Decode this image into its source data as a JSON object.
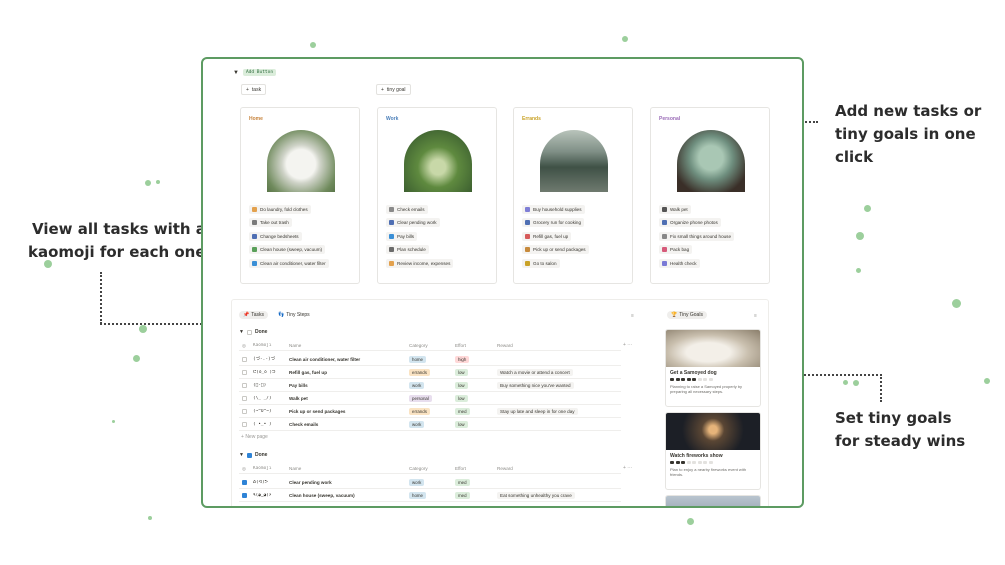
{
  "callouts": {
    "left": [
      "View all tasks with a",
      "kaomoji for each one"
    ],
    "top_right": [
      "Add new tasks or",
      "tiny goals in one",
      "click"
    ],
    "bottom_right": [
      "Set tiny goals",
      "for steady wins"
    ]
  },
  "toggle_label": "Add Button",
  "buttons": {
    "task": "task",
    "tiny_goal": "tiny goal"
  },
  "cards": [
    {
      "title": "Home",
      "color": "#c7833c",
      "items": [
        {
          "label": "Do laundry, fold clothes",
          "icon_color": "#e3a14d"
        },
        {
          "label": "Take out trash",
          "icon_color": "#7a7a7a"
        },
        {
          "label": "Change bedsheets",
          "icon_color": "#4f6fb3"
        },
        {
          "label": "Clean house (sweep, vacuum)",
          "icon_color": "#5aa05a"
        },
        {
          "label": "Clean air conditioner, water filter",
          "icon_color": "#3a8fd6"
        }
      ]
    },
    {
      "title": "Work",
      "color": "#4b7fb9",
      "items": [
        {
          "label": "Check emails",
          "icon_color": "#8a8a8a"
        },
        {
          "label": "Clear pending work",
          "icon_color": "#4f6fb3"
        },
        {
          "label": "Pay bills",
          "icon_color": "#3a8fd6"
        },
        {
          "label": "Plan schedule",
          "icon_color": "#6b6b6b"
        },
        {
          "label": "Review income, expenses",
          "icon_color": "#e3a14d"
        }
      ]
    },
    {
      "title": "Errands",
      "color": "#c9a227",
      "items": [
        {
          "label": "Buy household supplies",
          "icon_color": "#7f7fd6"
        },
        {
          "label": "Grocery run for cooking",
          "icon_color": "#4f6fb3"
        },
        {
          "label": "Refill gas, fuel up",
          "icon_color": "#d65a5a"
        },
        {
          "label": "Pick up or send packages",
          "icon_color": "#c78a3c"
        },
        {
          "label": "Go to salon",
          "icon_color": "#c9a227"
        }
      ]
    },
    {
      "title": "Personal",
      "color": "#9a6bb7",
      "items": [
        {
          "label": "Walk pet",
          "icon_color": "#555555"
        },
        {
          "label": "Organize phone photos",
          "icon_color": "#4f6fb3"
        },
        {
          "label": "Fix small things around house",
          "icon_color": "#888888"
        },
        {
          "label": "Pack bag",
          "icon_color": "#d65a7a"
        },
        {
          "label": "Health check",
          "icon_color": "#7a7ad6"
        }
      ]
    }
  ],
  "tabs": [
    "Tasks",
    "Tiny Steps"
  ],
  "goal_tab": "Tiny Goals",
  "groups": {
    "not_done": "Done",
    "done": "Done"
  },
  "columns": [
    "Kaomoji",
    "Name",
    "Category",
    "Effort",
    "Reward"
  ],
  "rows_open": [
    {
      "kaomoji": "(づ-.-)づ",
      "name": "Clean air conditioner, water filter",
      "category": "home",
      "effort": "high",
      "reward": ""
    },
    {
      "kaomoji": "ᕦ(ò_óˇ)ᕤ",
      "name": "Refill gas, fuel up",
      "category": "errands",
      "effort": "low",
      "reward": "Watch a movie or attend a concert"
    },
    {
      "kaomoji": "(ﾟ-ﾟ)",
      "name": "Pay bills",
      "category": "work",
      "effort": "low",
      "reward": "Buy something nice you've wanted"
    },
    {
      "kaomoji": "(\\_ _/)",
      "name": "Walk pet",
      "category": "personal",
      "effort": "low",
      "reward": ""
    },
    {
      "kaomoji": "(~^O^~)",
      "name": "Pick up or send packages",
      "category": "errands",
      "effort": "med",
      "reward": "Stay up late and sleep in for one day"
    },
    {
      "kaomoji": "( •_• )",
      "name": "Check emails",
      "category": "work",
      "effort": "low",
      "reward": ""
    }
  ],
  "new_page": "New page",
  "rows_done": [
    {
      "kaomoji": "ᕕ(ᐛ)ᕗ",
      "name": "Clear pending work",
      "category": "work",
      "effort": "med",
      "reward": ""
    },
    {
      "kaomoji": "٩(◕‿◕)۶",
      "name": "Clean house (sweep, vacuum)",
      "category": "home",
      "effort": "med",
      "reward": "Eat something unhealthy you crave"
    }
  ],
  "tag_colors": {
    "home": "#d3e5ef",
    "errands": "#fae3c3",
    "work": "#d3e5ef",
    "personal": "#e8deee",
    "high": "#ffd8d8",
    "low": "#dbeddb",
    "med": "#dbeddb"
  },
  "goals": [
    {
      "title": "Get a Samoyed dog",
      "desc": "Planning to raise a Samoyed properly by preparing all necessary steps.",
      "progress": 0.6
    },
    {
      "title": "Watch fireworks show",
      "desc": "Plan to enjoy a nearby fireworks event with friends.",
      "progress": 0.4
    }
  ]
}
